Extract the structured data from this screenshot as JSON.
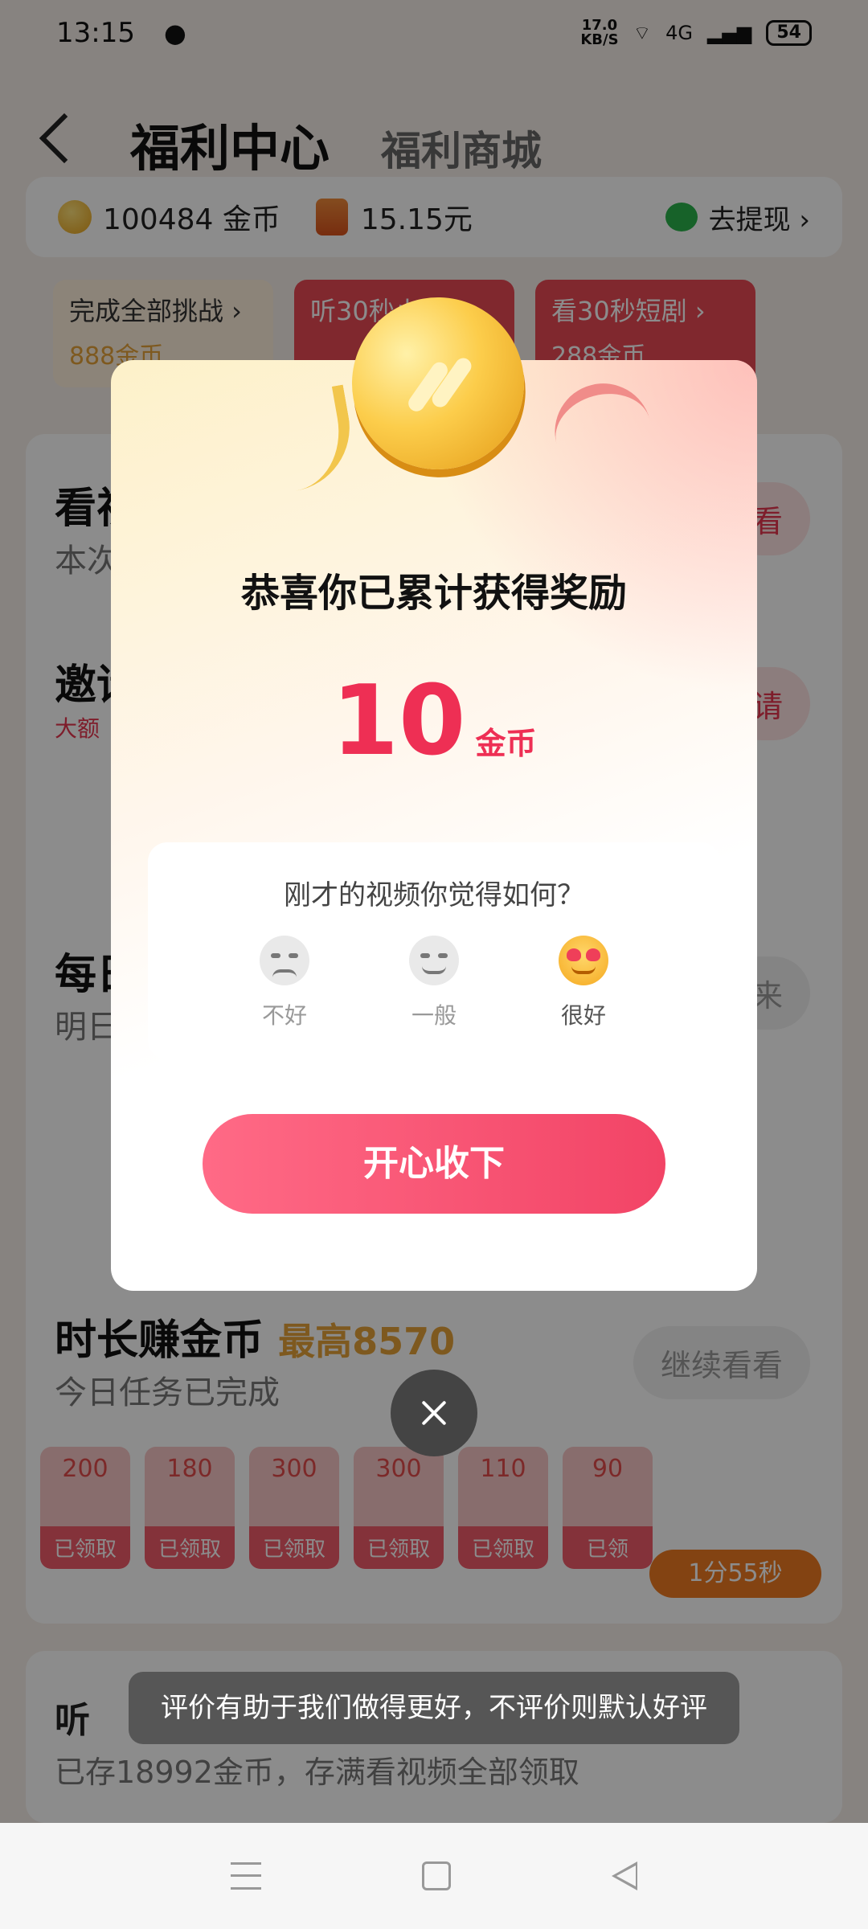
{
  "status_bar": {
    "time": "13:15",
    "net_speed": "17.0",
    "net_unit": "KB/S",
    "signal": "4G",
    "battery": "54"
  },
  "header": {
    "title": "福利中心",
    "tab_mall": "福利商城"
  },
  "balance": {
    "coins": "100484 金币",
    "cash": "15.15元",
    "withdraw_label": "去提现 ›"
  },
  "challenge_chips": [
    {
      "label": "完成全部挑战 ›",
      "amount": "888金币"
    },
    {
      "label": "听30秒小说 ›",
      "amount": ""
    },
    {
      "label": "看30秒短剧 ›",
      "amount": "288金币"
    }
  ],
  "tasks": {
    "watch_title": "看视频",
    "watch_sub": "本次",
    "watch_btn": "看",
    "invite_title": "邀请",
    "invite_tag": "大额",
    "invite_btn": "请",
    "daily_title": "每日",
    "daily_sub": "明日",
    "daily_btn": "来",
    "duration_title": "时长赚金币",
    "duration_max": "最高8570",
    "duration_sub": "今日任务已完成",
    "duration_btn": "继续看看",
    "listen_title": "听",
    "listen_sub": "已存18992金币，存满看视频全部领取"
  },
  "reward_tiles": [
    {
      "value": "200",
      "foot": "已领取"
    },
    {
      "value": "180",
      "foot": "已领取"
    },
    {
      "value": "300",
      "foot": "已领取"
    },
    {
      "value": "300",
      "foot": "已领取"
    },
    {
      "value": "110",
      "foot": "已领取"
    },
    {
      "value": "90",
      "foot": "已领"
    }
  ],
  "timer": "1分55秒",
  "modal": {
    "heading": "恭喜你已累计获得奖励",
    "amount": "10",
    "unit": "金币",
    "question": "刚才的视频你觉得如何？",
    "options": [
      {
        "label": "不好",
        "icon": "unamused-face-icon"
      },
      {
        "label": "一般",
        "icon": "grinning-face-icon"
      },
      {
        "label": "很好",
        "icon": "heart-eyes-face-icon"
      }
    ],
    "accept_label": "开心收下"
  },
  "toast": "评价有助于我们做得更好，不评价则默认好评",
  "colors": {
    "accent_red": "#ee2f54",
    "button_gradient_start": "#ff6a86",
    "button_gradient_end": "#f24466",
    "coin_gold": "#fccd4b"
  }
}
